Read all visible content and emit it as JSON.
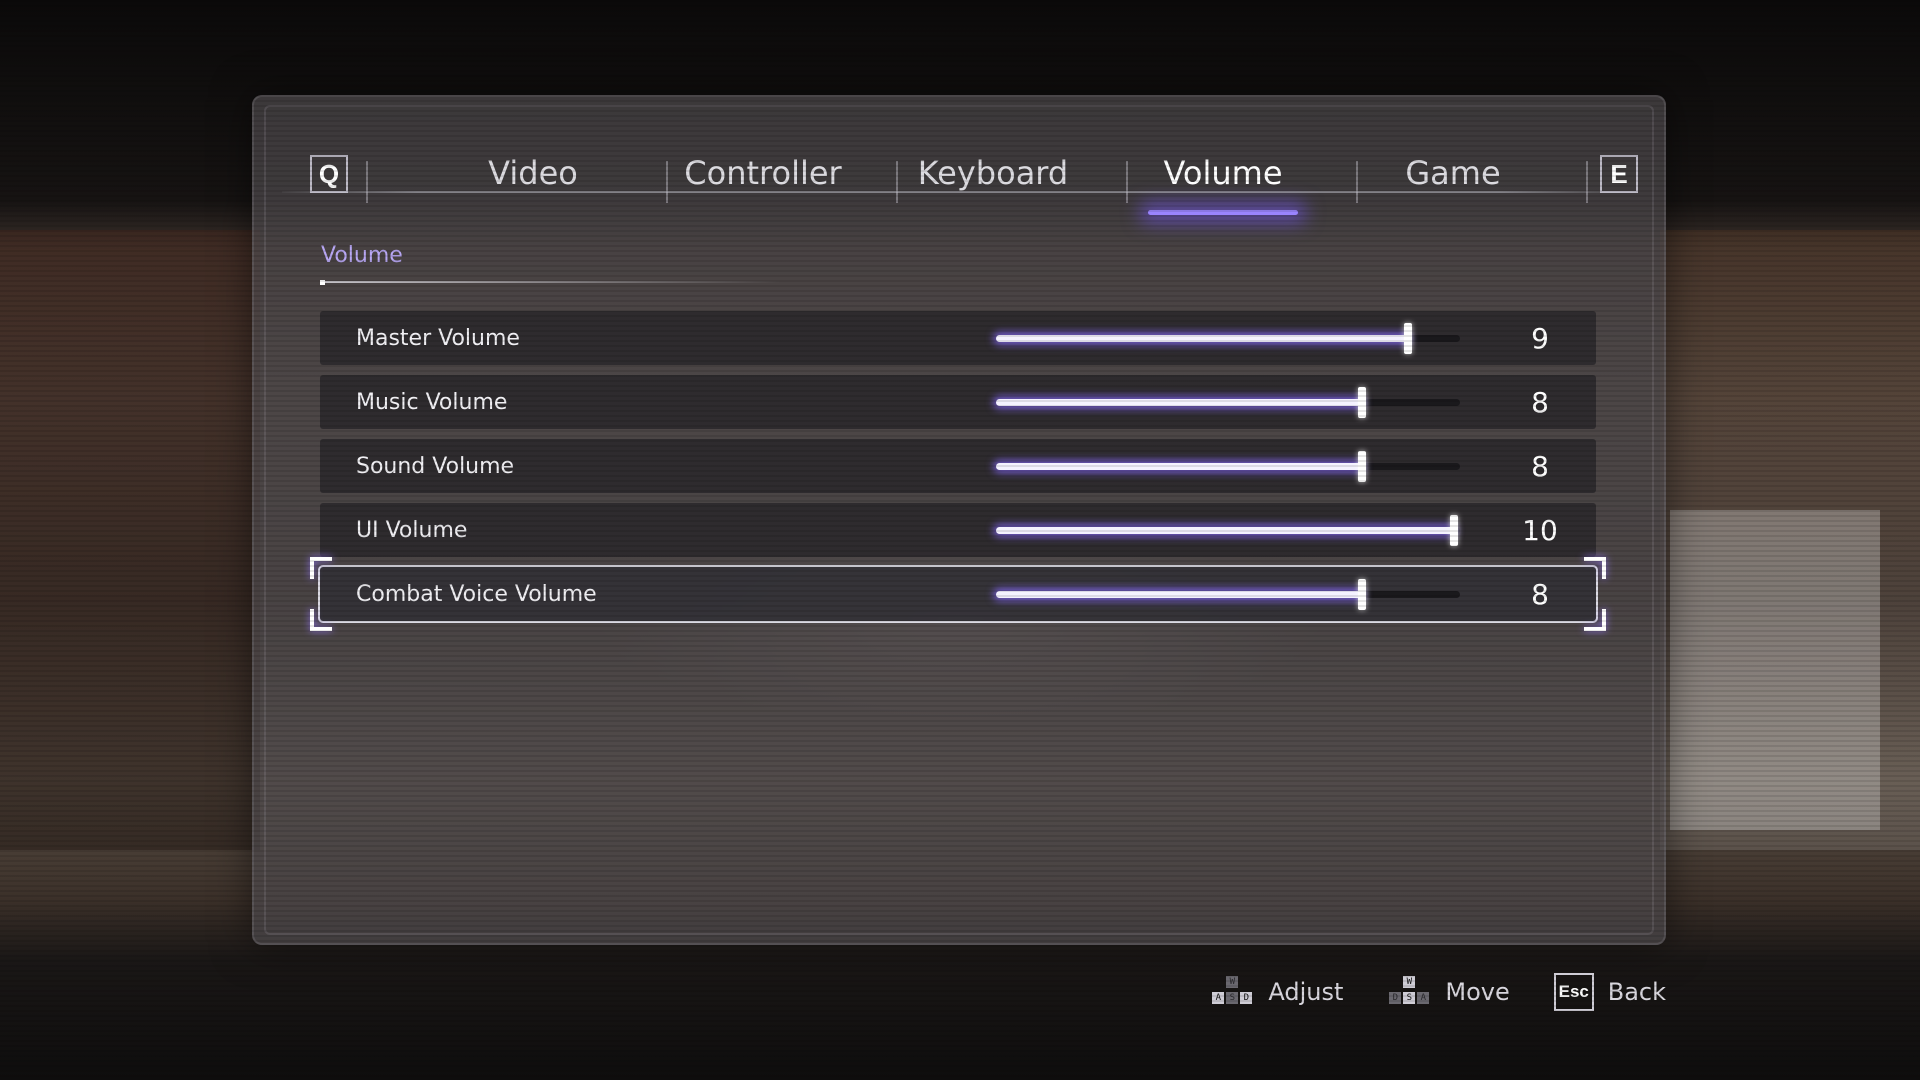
{
  "tabs": {
    "prev_key": "Q",
    "next_key": "E",
    "items": [
      {
        "label": "Video"
      },
      {
        "label": "Controller"
      },
      {
        "label": "Keyboard"
      },
      {
        "label": "Volume",
        "active": true
      },
      {
        "label": "Game"
      }
    ]
  },
  "section": {
    "title": "Volume"
  },
  "settings": {
    "max": 10,
    "rows": [
      {
        "label": "Master Volume",
        "value": 9,
        "display": "9",
        "fill": 0.9
      },
      {
        "label": "Music Volume",
        "value": 8,
        "display": "8",
        "fill": 0.8
      },
      {
        "label": "Sound Volume",
        "value": 8,
        "display": "8",
        "fill": 0.8
      },
      {
        "label": "UI Volume",
        "value": 10,
        "display": "10",
        "fill": 1.0
      },
      {
        "label": "Combat Voice Volume",
        "value": 8,
        "display": "8",
        "fill": 0.8,
        "selected": true
      }
    ]
  },
  "hints": {
    "adjust": {
      "label": "Adjust",
      "keys": [
        "W",
        "A",
        "S",
        "D"
      ]
    },
    "move": {
      "label": "Move",
      "keys": [
        "W",
        "D",
        "S",
        "A"
      ]
    },
    "back": {
      "label": "Back",
      "key": "Esc"
    }
  },
  "colors": {
    "accent": "#9a84ff",
    "section_title": "#b9a8f5"
  }
}
